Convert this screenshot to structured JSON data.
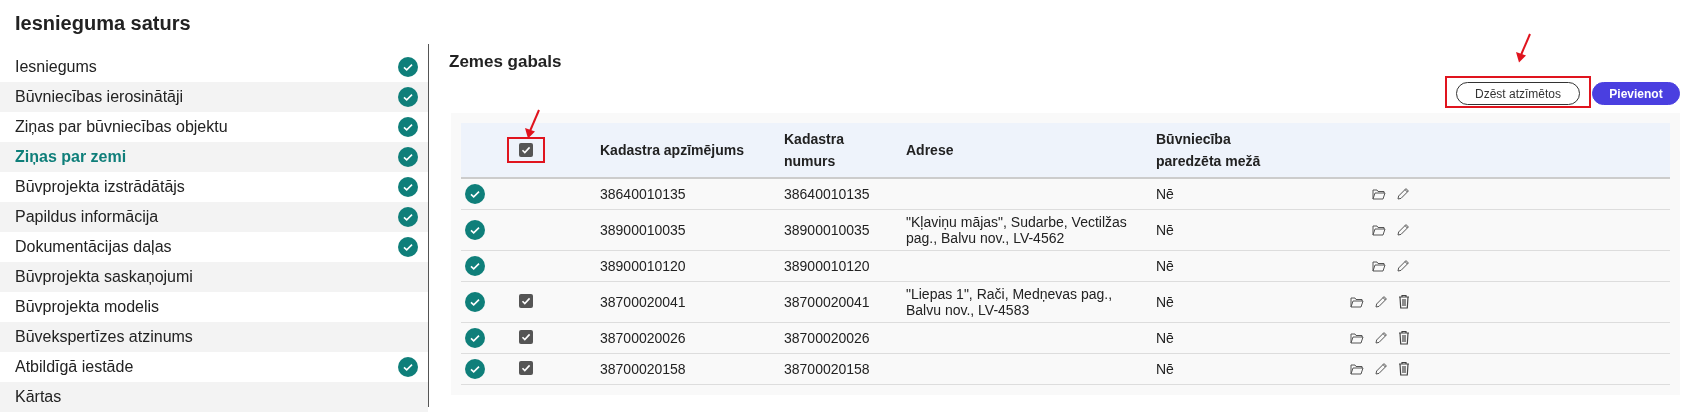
{
  "page_title": "Iesnieguma saturs",
  "sidebar": {
    "items": [
      {
        "label": "Iesniegums",
        "selected": false,
        "completed": true
      },
      {
        "label": "Būvniecības ierosinātāji",
        "selected": false,
        "completed": true
      },
      {
        "label": "Ziņas par būvniecības objektu",
        "selected": false,
        "completed": true
      },
      {
        "label": "Ziņas par zemi",
        "selected": true,
        "completed": true
      },
      {
        "label": "Būvprojekta izstrādātājs",
        "selected": false,
        "completed": true
      },
      {
        "label": "Papildus informācija",
        "selected": false,
        "completed": true
      },
      {
        "label": "Dokumentācijas daļas",
        "selected": false,
        "completed": true
      },
      {
        "label": "Būvprojekta saskaņojumi",
        "selected": false,
        "completed": false
      },
      {
        "label": "Būvprojekta modelis",
        "selected": false,
        "completed": false
      },
      {
        "label": "Būvekspertīzes atzinums",
        "selected": false,
        "completed": false
      },
      {
        "label": "Atbildīgā iestāde",
        "selected": false,
        "completed": true
      },
      {
        "label": "Kārtas",
        "selected": false,
        "completed": false
      }
    ]
  },
  "section": {
    "title": "Zemes gabals",
    "buttons": [
      {
        "label": "Dzēst atzīmētos",
        "kind": "outline",
        "highlighted": true
      },
      {
        "label": "Pievienot",
        "kind": "primary",
        "highlighted": false
      }
    ],
    "table": {
      "select_all": {
        "checked": true,
        "highlighted": true
      },
      "columns": [
        "Kadastra apzīmējums",
        "Kadastra numurs",
        "Adrese",
        "Būvniecība paredzēta mežā"
      ],
      "rows": [
        {
          "valid": true,
          "checked": false,
          "cells": [
            "38640010135",
            "38640010135",
            "",
            "Nē"
          ],
          "deletable": false
        },
        {
          "valid": true,
          "checked": false,
          "cells": [
            "38900010035",
            "38900010035",
            "\"Kļaviņu mājas\", Sudarbe, Vectilžas pag., Balvu nov., LV-4562",
            "Nē"
          ],
          "deletable": false
        },
        {
          "valid": true,
          "checked": false,
          "cells": [
            "38900010120",
            "38900010120",
            "",
            "Nē"
          ],
          "deletable": false
        },
        {
          "valid": true,
          "checked": true,
          "cells": [
            "38700020041",
            "38700020041",
            "\"Liepas 1\", Rači, Medņevas pag., Balvu nov., LV-4583",
            "Nē"
          ],
          "deletable": true
        },
        {
          "valid": true,
          "checked": true,
          "cells": [
            "38700020026",
            "38700020026",
            "",
            "Nē"
          ],
          "deletable": true
        },
        {
          "valid": true,
          "checked": true,
          "cells": [
            "38700020158",
            "38700020158",
            "",
            "Nē"
          ],
          "deletable": true
        }
      ]
    }
  }
}
